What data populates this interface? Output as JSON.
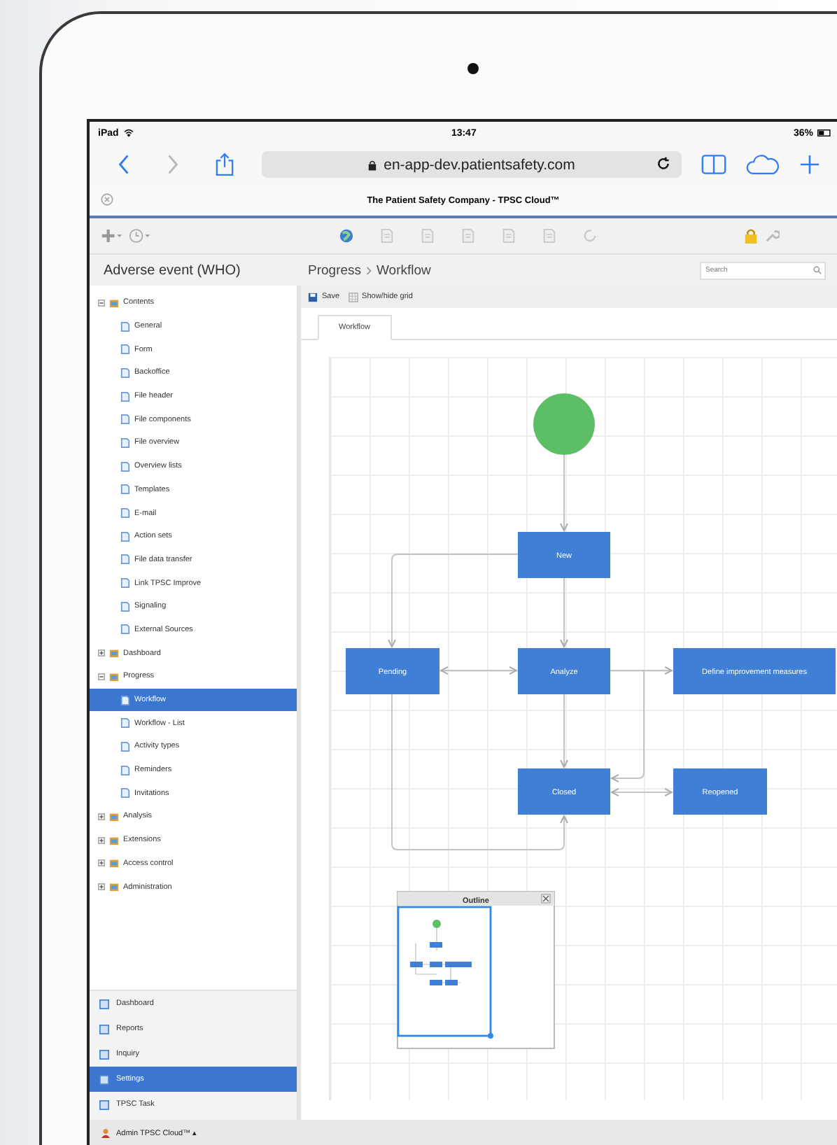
{
  "status_bar": {
    "device": "iPad",
    "time": "13:47",
    "battery": "36%"
  },
  "browser": {
    "url": "en-app-dev.patientsafety.com",
    "page_title": "The Patient Safety Company - TPSC Cloud™"
  },
  "header": {
    "title": "Adverse event (WHO)",
    "breadcrumb": [
      "Progress",
      "Workflow"
    ],
    "search": {
      "placeholder": "Search"
    }
  },
  "tree": [
    {
      "label": "Contents",
      "expanded": true,
      "selected": false,
      "children": [
        {
          "label": "General",
          "selected": false
        },
        {
          "label": "Form",
          "selected": false
        },
        {
          "label": "Backoffice",
          "selected": false
        },
        {
          "label": "File header",
          "selected": false
        },
        {
          "label": "File components",
          "selected": false
        },
        {
          "label": "File overview",
          "selected": false
        },
        {
          "label": "Overview lists",
          "selected": false
        },
        {
          "label": "Templates",
          "selected": false
        },
        {
          "label": "E-mail",
          "selected": false
        },
        {
          "label": "Action sets",
          "selected": false
        },
        {
          "label": "File data transfer",
          "selected": false
        },
        {
          "label": "Link TPSC Improve",
          "selected": false
        },
        {
          "label": "Signaling",
          "selected": false
        },
        {
          "label": "External Sources",
          "selected": false
        }
      ]
    },
    {
      "label": "Dashboard",
      "expanded": false,
      "selected": false
    },
    {
      "label": "Progress",
      "expanded": true,
      "selected": false,
      "children": [
        {
          "label": "Workflow",
          "selected": true
        },
        {
          "label": "Workflow - List",
          "selected": false
        },
        {
          "label": "Activity types",
          "selected": false
        },
        {
          "label": "Reminders",
          "selected": false
        },
        {
          "label": "Invitations",
          "selected": false
        }
      ]
    },
    {
      "label": "Analysis",
      "expanded": false,
      "selected": false
    },
    {
      "label": "Extensions",
      "expanded": false,
      "selected": false
    },
    {
      "label": "Access control",
      "expanded": false,
      "selected": false
    },
    {
      "label": "Administration",
      "expanded": false,
      "selected": false
    }
  ],
  "bottom_nav": [
    {
      "label": "Dashboard",
      "selected": false
    },
    {
      "label": "Reports",
      "selected": false
    },
    {
      "label": "Inquiry",
      "selected": false
    },
    {
      "label": "Settings",
      "selected": true
    },
    {
      "label": "TPSC Task",
      "selected": false
    }
  ],
  "user_menu": {
    "label": "Admin TPSC Cloud™",
    "caret": "▴"
  },
  "editor": {
    "toolbar": [
      "Save",
      "Show/hide grid"
    ],
    "tabs": [
      {
        "label": "Workflow",
        "selected": true
      }
    ],
    "nodes": [
      {
        "kind": "start"
      },
      {
        "kind": "state",
        "label": "New"
      },
      {
        "kind": "state",
        "label": "Pending"
      },
      {
        "kind": "state",
        "label": "Analyze"
      },
      {
        "kind": "state",
        "label": "Define improvement measures"
      },
      {
        "kind": "state",
        "label": "Closed"
      },
      {
        "kind": "state",
        "label": "Reopened"
      }
    ],
    "outline": {
      "title": "Outline"
    }
  }
}
